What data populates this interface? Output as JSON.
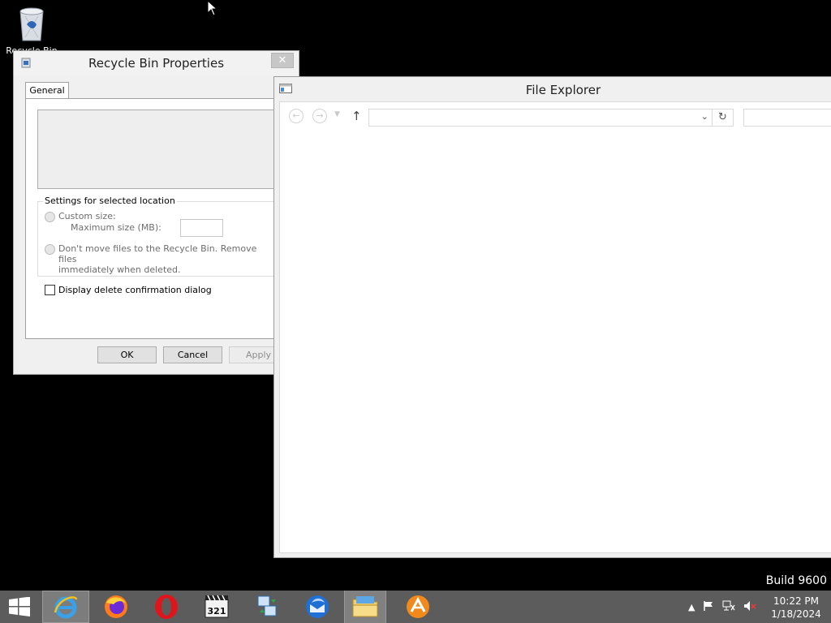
{
  "desktop": {
    "recycle_bin_label": "Recycle Bin"
  },
  "dialog": {
    "title": "Recycle Bin Properties",
    "close_glyph": "✕",
    "tab_general": "General",
    "group_title": "Settings for selected location",
    "custom_size_label": "Custom size:",
    "max_size_label": "Maximum size (MB):",
    "max_size_value": "",
    "dont_move_line1": "Don't move files to the Recycle Bin. Remove files",
    "dont_move_line2": "immediately when deleted.",
    "confirm_label": "Display delete confirmation dialog",
    "ok": "OK",
    "cancel": "Cancel",
    "apply": "Apply"
  },
  "explorer": {
    "title": "File Explorer",
    "address_value": "",
    "search_placeholder": ""
  },
  "build": "Build 9600",
  "taskbar": {
    "apps": [
      "start-icon",
      "internet-explorer-icon",
      "firefox-icon",
      "opera-icon",
      "media-player-classic-icon",
      "network-transfer-icon",
      "thunderbird-icon",
      "file-explorer-icon",
      "app-icon"
    ],
    "clock_time": "10:22 PM",
    "clock_date": "1/18/2024"
  },
  "colors": {
    "taskbar": "#5c5c5c",
    "desktop": "#000000"
  }
}
